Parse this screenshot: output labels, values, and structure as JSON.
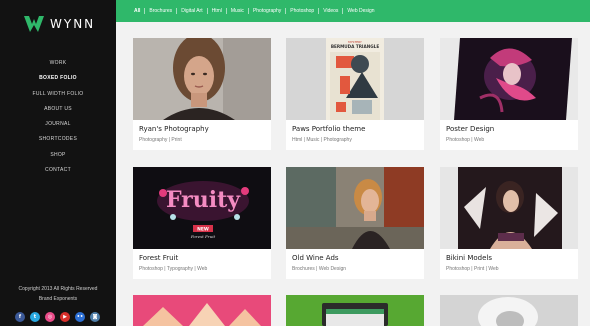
{
  "logo": {
    "text": "WYNN"
  },
  "nav": {
    "items": [
      {
        "label": "WORK",
        "active": false
      },
      {
        "label": "BOXED FOLIO",
        "active": true
      },
      {
        "label": "FULL WIDTH FOLIO",
        "active": false
      },
      {
        "label": "ABOUT US",
        "active": false
      },
      {
        "label": "JOURNAL",
        "active": false
      },
      {
        "label": "SHORTCODES",
        "active": false
      },
      {
        "label": "SHOP",
        "active": false
      },
      {
        "label": "CONTACT",
        "active": false
      }
    ]
  },
  "footer": {
    "copyright": "Copyright 2013 All Rights Reserved",
    "brand": "Brand Exponents",
    "socials": [
      {
        "icon": "facebook-icon",
        "glyph": "f",
        "color": "#3b5998"
      },
      {
        "icon": "twitter-icon",
        "glyph": "t",
        "color": "#29a9e1"
      },
      {
        "icon": "dribbble-icon",
        "glyph": "◎",
        "color": "#ea4c89"
      },
      {
        "icon": "youtube-icon",
        "glyph": "▶",
        "color": "#d9302b"
      },
      {
        "icon": "flickr-icon",
        "glyph": "••",
        "color": "#2c6fd4"
      },
      {
        "icon": "instagram-icon",
        "glyph": "◙",
        "color": "#4f7ea8"
      }
    ]
  },
  "filters": [
    "All",
    "Brochures",
    "Digital Art",
    "Html",
    "Music",
    "Photography",
    "Photoshop",
    "Videos",
    "Web Design"
  ],
  "portfolio": [
    {
      "title": "Ryan's Photography",
      "tags": "Photography | Print"
    },
    {
      "title": "Paws Portfolio theme",
      "tags": "Html | Music | Photography"
    },
    {
      "title": "Poster Design",
      "tags": "Photoshop | Web"
    },
    {
      "title": "Forest Fruit",
      "tags": "Photoshop | Typography | Web"
    },
    {
      "title": "Old Wine Ads",
      "tags": "Brochures | Web Design"
    },
    {
      "title": "Bikini Models",
      "tags": "Photoshop | Print | Web"
    }
  ],
  "thumb_text": {
    "paws_header": "BERMUDA TRIANGLE",
    "paws_small": "MYSTERY",
    "forest_word": "Fruity",
    "forest_badge": "NEW",
    "forest_sub": "Forest Fruit"
  },
  "colors": {
    "accent": "#2fb86a",
    "sidebar": "#121212",
    "background": "#f2f2f2"
  }
}
